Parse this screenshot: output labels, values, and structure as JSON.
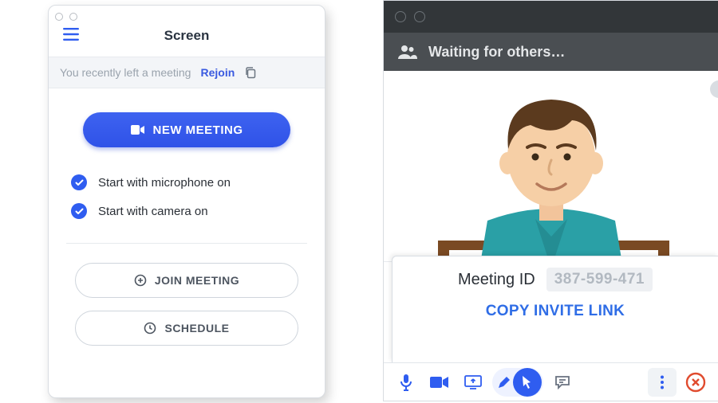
{
  "left": {
    "title": "Screen",
    "banner": {
      "text": "You recently left a meeting",
      "action": "Rejoin"
    },
    "new_meeting_label": "NEW MEETING",
    "toggles": [
      {
        "label": "Start with microphone on"
      },
      {
        "label": "Start with camera on"
      }
    ],
    "join_label": "JOIN MEETING",
    "schedule_label": "SCHEDULE"
  },
  "right": {
    "status": "Waiting for others…",
    "meeting_id_label": "Meeting ID",
    "meeting_id_value": "387-599-471",
    "copy_link_label": "COPY INVITE LINK"
  },
  "colors": {
    "primary": "#2f5df0",
    "subbar": "#4a4e52",
    "titlebar": "#323639",
    "danger": "#e04b2e"
  }
}
